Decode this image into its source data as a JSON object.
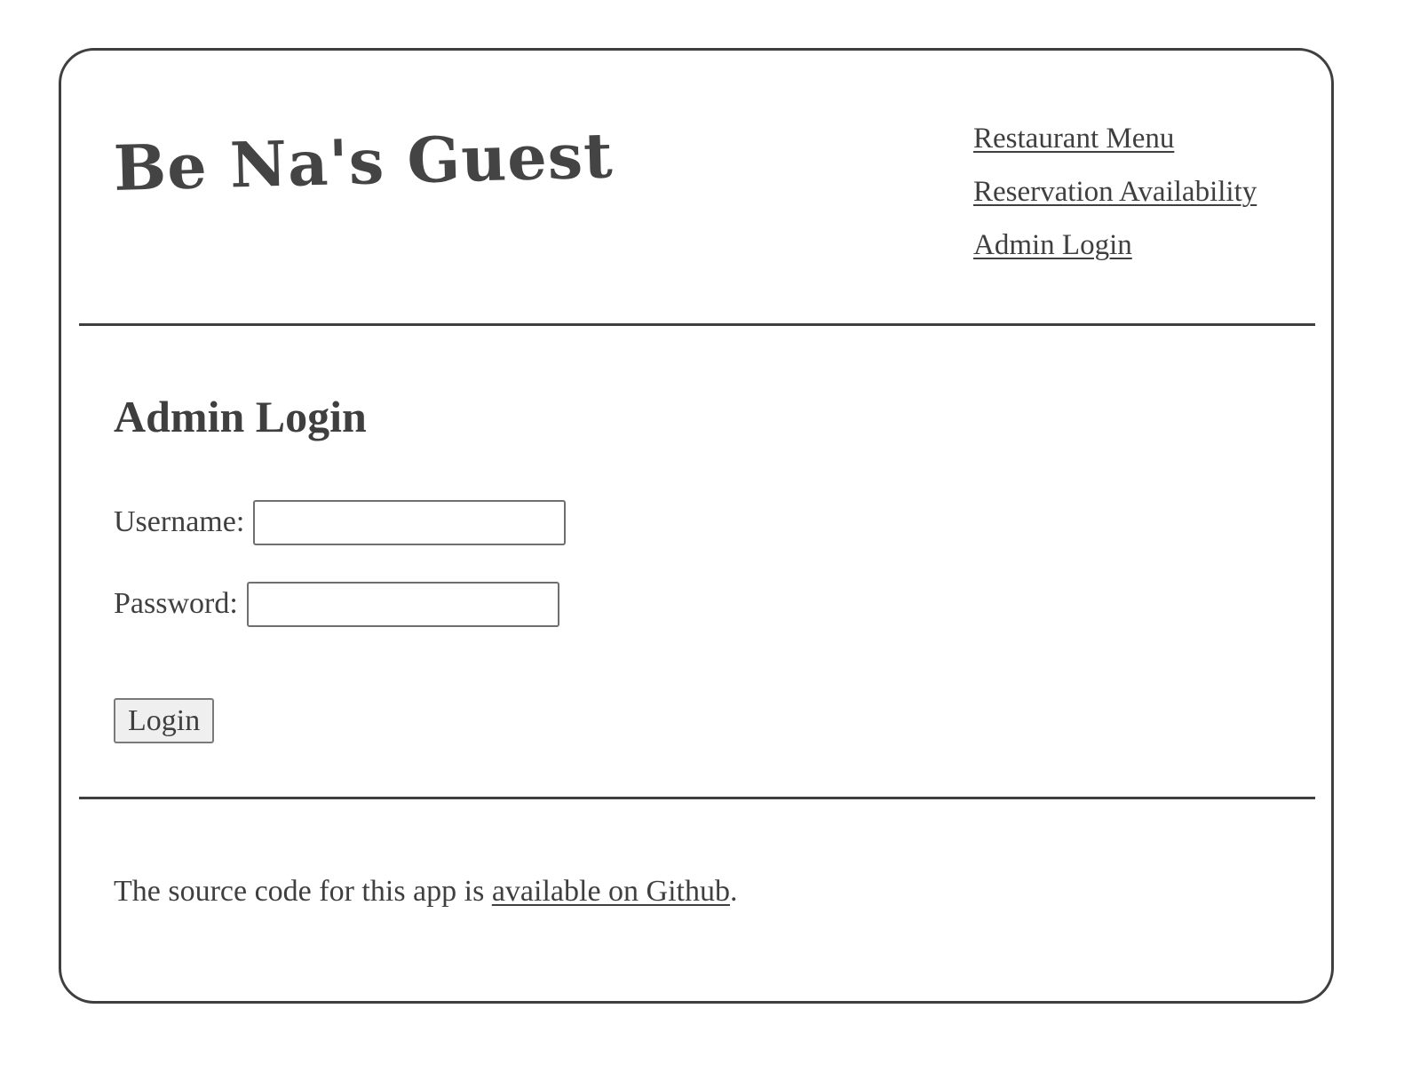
{
  "header": {
    "site_title": "Be Na's Guest"
  },
  "nav": {
    "items": [
      {
        "label": "Restaurant Menu"
      },
      {
        "label": "Reservation Availability"
      },
      {
        "label": "Admin Login"
      }
    ]
  },
  "main": {
    "title": "Admin Login",
    "form": {
      "username_label": "Username:",
      "username_value": "",
      "password_label": "Password:",
      "password_value": "",
      "login_label": "Login"
    }
  },
  "footer": {
    "text_before": "The source code for this app is ",
    "link_text": "available on Github",
    "text_after": "."
  },
  "colors": {
    "text": "#3f3f3f",
    "border": "#3f3f3f",
    "button_bg": "#efefef",
    "background": "#ffffff"
  }
}
